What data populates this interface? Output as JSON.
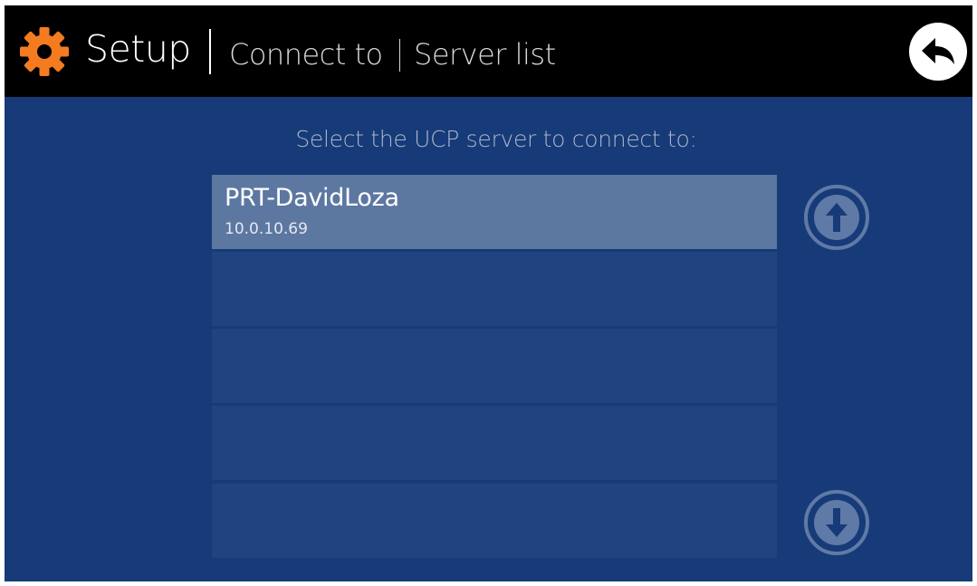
{
  "header": {
    "title": "Setup",
    "breadcrumb": [
      "Connect to",
      "Server list"
    ],
    "icons": {
      "settings": "gear-icon",
      "back": "back-arrow-icon"
    },
    "accent_color": "#f47b20"
  },
  "main": {
    "prompt": "Select the UCP server to connect to:",
    "servers": [
      {
        "name": "PRT-DavidLoza",
        "address": "10.0.10.69",
        "selected": true
      },
      {
        "name": "",
        "address": "",
        "selected": false
      },
      {
        "name": "",
        "address": "",
        "selected": false
      },
      {
        "name": "",
        "address": "",
        "selected": false
      },
      {
        "name": "",
        "address": "",
        "selected": false
      }
    ],
    "scroll_icons": {
      "up": "arrow-up-circle-icon",
      "down": "arrow-down-circle-icon"
    }
  },
  "colors": {
    "background": "#173a78",
    "header": "#000000",
    "row": "#1f4480",
    "row_selected": "#5c78a1"
  }
}
